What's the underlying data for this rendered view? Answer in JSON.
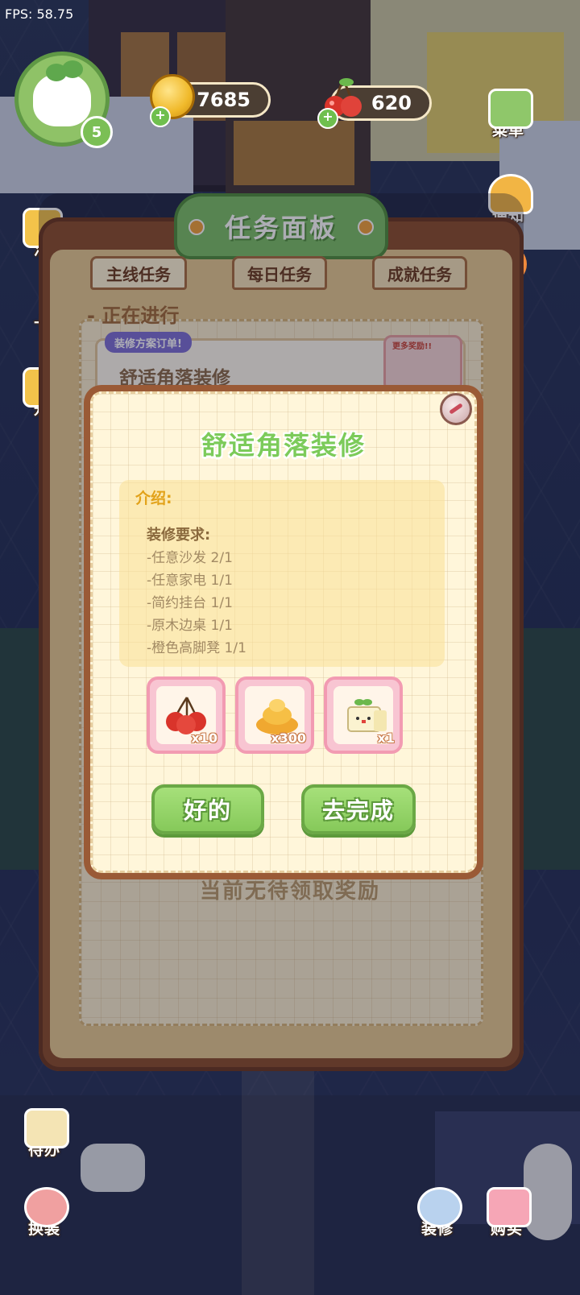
{
  "hud": {
    "fps": "FPS: 58.75",
    "level": "5",
    "coins": "7685",
    "cherries": "620",
    "plus": "+"
  },
  "side_buttons": {
    "menu": "菜单",
    "notify": "通知",
    "left_1": "活",
    "left_2": "十",
    "left_3": "升",
    "todo": "待办",
    "outfit": "换装",
    "decorate": "装修",
    "shop": "购买"
  },
  "task_panel": {
    "title": "任务面板",
    "tabs": [
      "主线任务",
      "每日任务",
      "成就任务"
    ],
    "active_tab": "主线任务",
    "section": "- 正在进行",
    "order_tag": "装修方案订单!",
    "order_name": "舒适角落装修",
    "more_reward": "更多奖励!!",
    "no_reward": "当前无待领取奖励"
  },
  "dialog": {
    "title": "舒适角落装修",
    "intro_label": "介绍:",
    "requirements_title": "装修要求:",
    "requirements": [
      "-任意沙发 2/1",
      "-任意家电 1/1",
      "-简约挂台 1/1",
      "-原木边桌 1/1",
      "-橙色高脚凳 1/1"
    ],
    "rewards": [
      {
        "icon": "cherry-icon",
        "qty": "x10"
      },
      {
        "icon": "gold-pile-icon",
        "qty": "x300"
      },
      {
        "icon": "sprout-box-icon",
        "qty": "x1"
      }
    ],
    "ok_label": "好的",
    "go_label": "去完成"
  },
  "colors": {
    "accent_green": "#86c95a",
    "panel_brown": "#8b4e2c",
    "reward_pink": "#f29bb2",
    "title_green": "#7ccb5a"
  }
}
